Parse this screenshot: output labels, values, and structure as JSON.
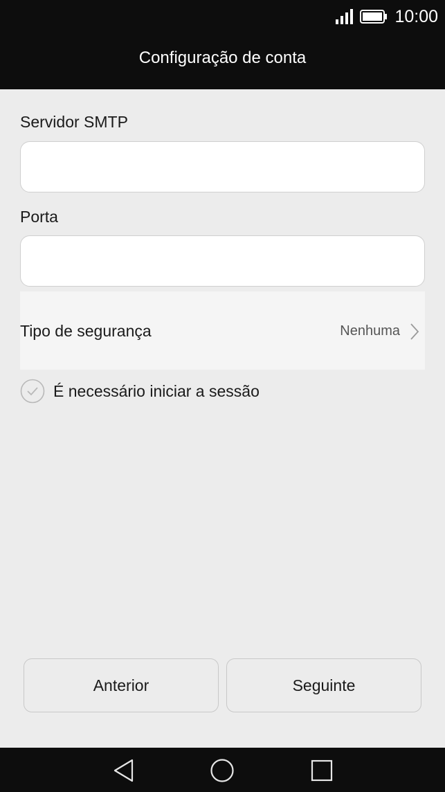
{
  "status_bar": {
    "time": "10:00",
    "signal_icon": "signal-icon",
    "battery_icon": "battery-icon"
  },
  "header": {
    "title": "Configuração de conta"
  },
  "form": {
    "smtp_server": {
      "label": "Servidor SMTP",
      "value": "",
      "placeholder": ""
    },
    "port": {
      "label": "Porta",
      "value": "",
      "placeholder": ""
    },
    "security_type": {
      "label": "Tipo de segurança",
      "value": "Nenhuma"
    },
    "login_required": {
      "label": "É necessário iniciar a sessão",
      "checked": false
    }
  },
  "buttons": {
    "previous_label": "Anterior",
    "next_label": "Seguinte"
  },
  "nav_bar": {
    "back_icon": "back-triangle-icon",
    "home_icon": "home-circle-icon",
    "recents_icon": "recents-square-icon"
  },
  "colors": {
    "header_bg": "#0d0d0d",
    "screen_bg": "#ececec",
    "input_bg": "#ffffff"
  }
}
